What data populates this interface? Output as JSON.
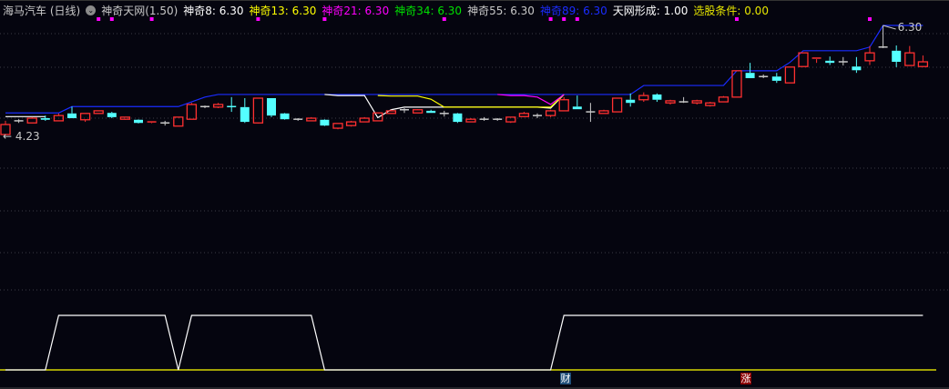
{
  "header": {
    "stock": "海马汽车 (日线)",
    "indicator": "神奇天网(1.50)",
    "items": [
      {
        "label": "神奇8: 6.30",
        "color": "#ffffff"
      },
      {
        "label": "神奇13: 6.30",
        "color": "#ffff00"
      },
      {
        "label": "神奇21: 6.30",
        "color": "#ff00ff"
      },
      {
        "label": "神奇34: 6.30",
        "color": "#00e000"
      },
      {
        "label": "神奇55: 6.30",
        "color": "#c8c8c8"
      },
      {
        "label": "神奇89: 6.30",
        "color": "#1a2cff"
      },
      {
        "label": "天网形成: 1.00",
        "color": "#ffffff"
      },
      {
        "label": "选股条件: 0.00",
        "color": "#e8e800"
      }
    ]
  },
  "badges": {
    "cai": "财",
    "zhang": "涨"
  },
  "colors": {
    "up": "#ff3030",
    "down": "#54ffff",
    "flat": "#c8c8c8",
    "ma89": "#1a2cff",
    "ma8": "#ffffff",
    "ma13": "#ffff00",
    "ma21": "#ff00ff",
    "marker": "#ff00ff",
    "signal": "#ffffff",
    "baseline": "#ffff00"
  },
  "chart_data": {
    "type": "candlestick",
    "ylim": [
      4.23,
      6.3
    ],
    "high_label": "6.30",
    "low_label": "4.23",
    "candles_ohlc": [
      [
        4.23,
        4.49,
        4.23,
        4.42
      ],
      [
        4.49,
        4.52,
        4.45,
        4.49
      ],
      [
        4.45,
        4.56,
        4.45,
        4.54
      ],
      [
        4.54,
        4.59,
        4.49,
        4.51
      ],
      [
        4.49,
        4.63,
        4.49,
        4.59
      ],
      [
        4.63,
        4.76,
        4.54,
        4.54
      ],
      [
        4.51,
        4.63,
        4.47,
        4.63
      ],
      [
        4.63,
        4.68,
        4.63,
        4.68
      ],
      [
        4.64,
        4.66,
        4.54,
        4.56
      ],
      [
        4.52,
        4.56,
        4.51,
        4.56
      ],
      [
        4.51,
        4.52,
        4.44,
        4.45
      ],
      [
        4.45,
        4.47,
        4.44,
        4.47
      ],
      [
        4.45,
        4.49,
        4.4,
        4.45
      ],
      [
        4.39,
        4.56,
        4.39,
        4.56
      ],
      [
        4.52,
        4.83,
        4.52,
        4.8
      ],
      [
        4.76,
        4.78,
        4.73,
        4.76
      ],
      [
        4.75,
        4.83,
        4.73,
        4.8
      ],
      [
        4.76,
        4.94,
        4.66,
        4.75
      ],
      [
        4.75,
        4.92,
        4.45,
        4.47
      ],
      [
        4.45,
        4.92,
        4.44,
        4.92
      ],
      [
        4.92,
        4.92,
        4.56,
        4.59
      ],
      [
        4.63,
        4.64,
        4.51,
        4.52
      ],
      [
        4.52,
        4.54,
        4.49,
        4.52
      ],
      [
        4.49,
        4.56,
        4.49,
        4.54
      ],
      [
        4.51,
        4.52,
        4.39,
        4.4
      ],
      [
        4.35,
        4.44,
        4.33,
        4.44
      ],
      [
        4.4,
        4.49,
        4.38,
        4.47
      ],
      [
        4.47,
        4.56,
        4.47,
        4.54
      ],
      [
        4.49,
        4.64,
        4.49,
        4.64
      ],
      [
        4.63,
        4.7,
        4.63,
        4.68
      ],
      [
        4.7,
        4.73,
        4.64,
        4.7
      ],
      [
        4.64,
        4.71,
        4.64,
        4.7
      ],
      [
        4.68,
        4.7,
        4.64,
        4.64
      ],
      [
        4.63,
        4.68,
        4.57,
        4.63
      ],
      [
        4.63,
        4.64,
        4.45,
        4.47
      ],
      [
        4.47,
        4.54,
        4.47,
        4.52
      ],
      [
        4.52,
        4.56,
        4.49,
        4.52
      ],
      [
        4.52,
        4.54,
        4.49,
        4.52
      ],
      [
        4.47,
        4.56,
        4.45,
        4.56
      ],
      [
        4.57,
        4.66,
        4.56,
        4.63
      ],
      [
        4.59,
        4.63,
        4.54,
        4.59
      ],
      [
        4.59,
        4.7,
        4.56,
        4.68
      ],
      [
        4.68,
        4.94,
        4.68,
        4.89
      ],
      [
        4.76,
        4.97,
        4.71,
        4.71
      ],
      [
        4.66,
        4.83,
        4.47,
        4.66
      ],
      [
        4.63,
        4.7,
        4.63,
        4.68
      ],
      [
        4.66,
        4.92,
        4.66,
        4.92
      ],
      [
        4.89,
        5.01,
        4.76,
        4.83
      ],
      [
        4.89,
        5.03,
        4.85,
        4.97
      ],
      [
        4.99,
        5.01,
        4.85,
        4.89
      ],
      [
        4.83,
        4.89,
        4.8,
        4.87
      ],
      [
        4.85,
        4.94,
        4.83,
        4.85
      ],
      [
        4.83,
        4.89,
        4.8,
        4.87
      ],
      [
        4.78,
        4.85,
        4.76,
        4.83
      ],
      [
        4.85,
        4.96,
        4.85,
        4.94
      ],
      [
        4.94,
        5.44,
        4.94,
        5.44
      ],
      [
        5.4,
        5.59,
        5.3,
        5.3
      ],
      [
        5.33,
        5.37,
        5.3,
        5.33
      ],
      [
        5.33,
        5.4,
        5.21,
        5.25
      ],
      [
        5.21,
        5.51,
        5.21,
        5.51
      ],
      [
        5.52,
        5.78,
        5.52,
        5.78
      ],
      [
        5.66,
        5.68,
        5.59,
        5.68
      ],
      [
        5.63,
        5.71,
        5.55,
        5.59
      ],
      [
        5.61,
        5.7,
        5.54,
        5.61
      ],
      [
        5.52,
        5.7,
        5.4,
        5.45
      ],
      [
        5.63,
        5.91,
        5.55,
        5.78
      ],
      [
        5.89,
        6.3,
        5.87,
        5.89
      ],
      [
        5.82,
        5.92,
        5.51,
        5.61
      ],
      [
        5.54,
        5.91,
        5.54,
        5.78
      ],
      [
        5.52,
        5.73,
        5.52,
        5.61
      ]
    ],
    "series": [
      {
        "name": "神奇89",
        "key": "ma89",
        "values": [
          4.64,
          4.64,
          4.64,
          4.64,
          4.64,
          4.76,
          4.76,
          4.76,
          4.76,
          4.76,
          4.76,
          4.76,
          4.76,
          4.76,
          4.85,
          4.94,
          4.99,
          4.99,
          4.99,
          4.99,
          4.99,
          4.99,
          4.99,
          4.99,
          4.99,
          4.99,
          4.99,
          4.99,
          4.99,
          4.99,
          4.99,
          4.99,
          4.99,
          4.99,
          4.99,
          4.99,
          4.99,
          4.99,
          4.99,
          4.99,
          4.99,
          4.99,
          4.99,
          4.99,
          4.99,
          4.99,
          4.99,
          4.99,
          5.16,
          5.16,
          5.16,
          5.16,
          5.16,
          5.16,
          5.16,
          5.44,
          5.44,
          5.44,
          5.44,
          5.6,
          5.82,
          5.82,
          5.82,
          5.82,
          5.82,
          5.89,
          6.3,
          6.3,
          6.3,
          6.3
        ]
      },
      {
        "name": "神奇8",
        "key": "ma8",
        "values": [
          4.57,
          4.57,
          4.57,
          4.57,
          null,
          null,
          null,
          null,
          null,
          null,
          null,
          null,
          null,
          null,
          null,
          null,
          null,
          null,
          null,
          null,
          null,
          null,
          null,
          null,
          4.99,
          4.97,
          4.97,
          4.97,
          4.55,
          4.7,
          4.75,
          4.75,
          4.75,
          4.75,
          4.75,
          4.75,
          4.75,
          4.75,
          4.75,
          4.75,
          4.75,
          4.73,
          4.99,
          null,
          null,
          null,
          null,
          null,
          null,
          null,
          null,
          null,
          null,
          null,
          null,
          null,
          null,
          null,
          null,
          null,
          null,
          null,
          null,
          null,
          null,
          null,
          null,
          null,
          null,
          null
        ]
      },
      {
        "name": "神奇13",
        "key": "ma13",
        "values": [
          null,
          null,
          null,
          null,
          null,
          null,
          null,
          null,
          null,
          null,
          null,
          null,
          null,
          null,
          null,
          null,
          null,
          null,
          null,
          null,
          null,
          null,
          null,
          null,
          null,
          null,
          null,
          null,
          4.97,
          4.96,
          4.96,
          4.96,
          4.9,
          4.75,
          4.75,
          4.75,
          4.75,
          4.75,
          4.75,
          4.75,
          4.75,
          4.75,
          4.99,
          null,
          null,
          null,
          null,
          null,
          null,
          null,
          null,
          null,
          null,
          null,
          null,
          null,
          null,
          null,
          null,
          null,
          null,
          null,
          null,
          null,
          null,
          null,
          null,
          null,
          null,
          null
        ]
      },
      {
        "name": "神奇21",
        "key": "ma21",
        "values": [
          null,
          null,
          null,
          null,
          null,
          null,
          null,
          null,
          null,
          null,
          null,
          null,
          null,
          null,
          null,
          null,
          null,
          null,
          null,
          null,
          null,
          null,
          null,
          null,
          null,
          null,
          null,
          null,
          null,
          null,
          null,
          null,
          null,
          null,
          null,
          null,
          null,
          4.99,
          4.97,
          4.97,
          4.94,
          4.8,
          4.99,
          null,
          null,
          null,
          null,
          null,
          null,
          null,
          null,
          null,
          null,
          null,
          null,
          null,
          null,
          null,
          null,
          null,
          null,
          null,
          null,
          null,
          null,
          null,
          null,
          null,
          null,
          null
        ]
      }
    ],
    "marker_indices": [
      7,
      8,
      11,
      19,
      24,
      33,
      41,
      42,
      43,
      55,
      65
    ],
    "signal_name": "天网形成",
    "signal": [
      0,
      0,
      0,
      0,
      1,
      1,
      1,
      1,
      1,
      1,
      1,
      1,
      1,
      0,
      1,
      1,
      1,
      1,
      1,
      1,
      1,
      1,
      1,
      1,
      0,
      0,
      0,
      0,
      0,
      0,
      0,
      0,
      0,
      0,
      0,
      0,
      0,
      0,
      0,
      0,
      0,
      0,
      1,
      1,
      1,
      1,
      1,
      1,
      1,
      1,
      1,
      1,
      1,
      1,
      1,
      1,
      1,
      1,
      1,
      1,
      1,
      1,
      1,
      1,
      1,
      1,
      1,
      1,
      1,
      1
    ]
  }
}
